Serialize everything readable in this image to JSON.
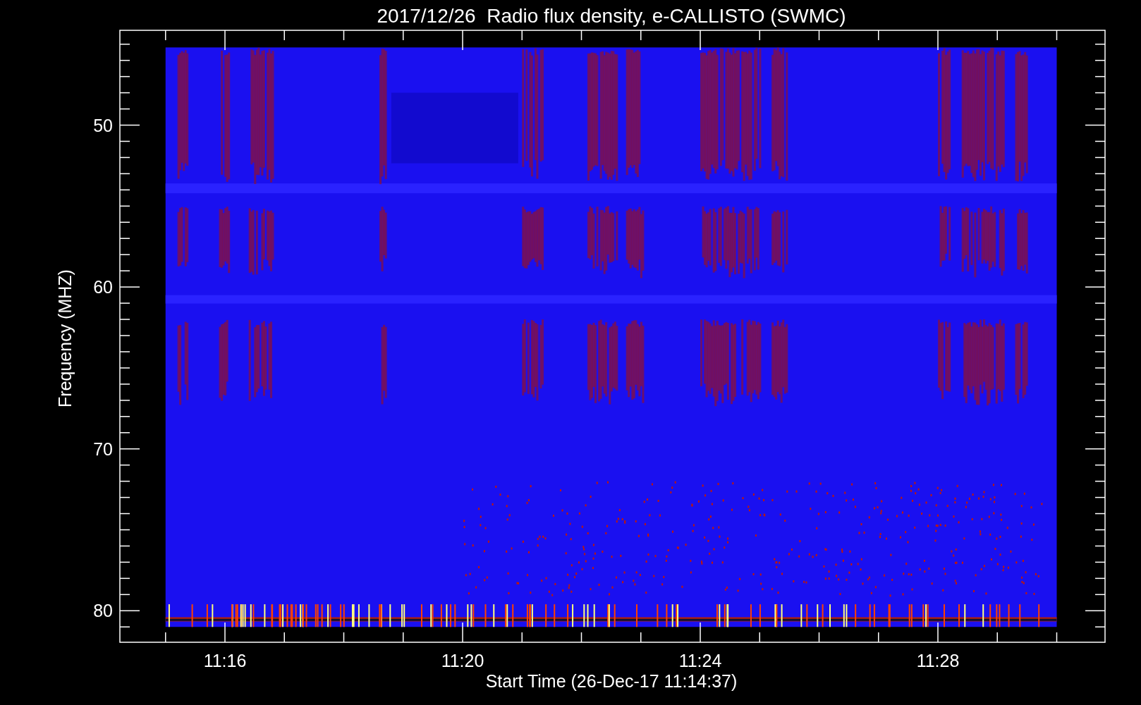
{
  "title": "2017/12/26  Radio flux density, e-CALLISTO (SWMC)",
  "y_axis": {
    "title": "Frequency (MHZ)",
    "ticks": [
      "50",
      "60",
      "70",
      "80"
    ]
  },
  "x_axis": {
    "title": "Start Time (26-Dec-17 11:14:37)",
    "ticks": [
      "11:16",
      "11:20",
      "11:24",
      "11:28"
    ]
  }
}
